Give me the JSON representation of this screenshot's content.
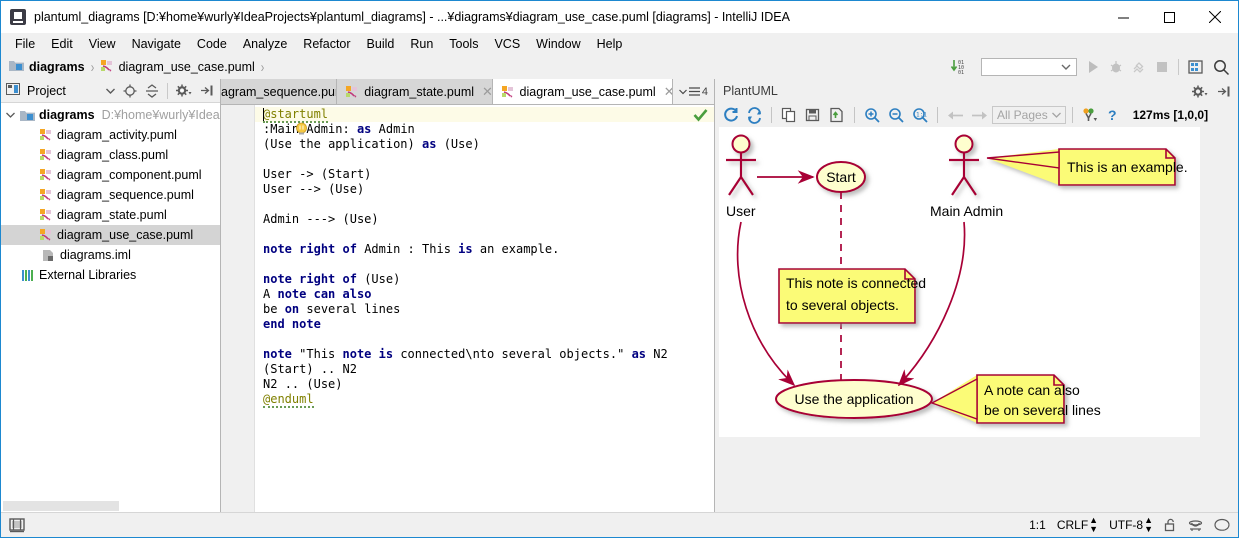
{
  "window": {
    "title": "plantuml_diagrams [D:¥home¥wurly¥IdeaProjects¥plantuml_diagrams] - ...¥diagrams¥diagram_use_case.puml [diagrams] - IntelliJ IDEA",
    "app_icon": "intellij-idea-icon",
    "minimize": "–",
    "maximize": "□",
    "close": "✕"
  },
  "menubar": {
    "items": [
      {
        "label": "File"
      },
      {
        "label": "Edit"
      },
      {
        "label": "View"
      },
      {
        "label": "Navigate"
      },
      {
        "label": "Code"
      },
      {
        "label": "Analyze"
      },
      {
        "label": "Refactor"
      },
      {
        "label": "Build"
      },
      {
        "label": "Run"
      },
      {
        "label": "Tools"
      },
      {
        "label": "VCS"
      },
      {
        "label": "Window"
      },
      {
        "label": "Help"
      }
    ]
  },
  "navbar": {
    "crumbs": [
      {
        "label": "diagrams",
        "icon": "module-folder-icon"
      },
      {
        "label": "diagram_use_case.puml",
        "icon": "puml-file-icon"
      }
    ],
    "separator": "›",
    "run_config_placeholder": "",
    "icons": [
      "download-binary-icon",
      "run-icon",
      "debug-icon",
      "coverage-icon",
      "stop-icon",
      "database-icon",
      "search-everywhere-icon"
    ]
  },
  "project_panel": {
    "title": "Project",
    "header_icon": "project-view-icon",
    "tools": [
      "chevron-down-icon",
      "locate-target-icon",
      "collapse-all-icon",
      "settings-gear-icon",
      "hide-panel-icon"
    ],
    "tree": [
      {
        "label": "diagrams",
        "path": "D:¥home¥wurly¥IdeaPro",
        "icon": "module-folder-icon",
        "indent": 0,
        "twisty": "⌄",
        "bold": true,
        "selected": false
      },
      {
        "label": "diagram_activity.puml",
        "path": "",
        "icon": "puml-file-icon",
        "indent": 1,
        "twisty": "",
        "bold": false,
        "selected": false
      },
      {
        "label": "diagram_class.puml",
        "path": "",
        "icon": "puml-file-icon",
        "indent": 1,
        "twisty": "",
        "bold": false,
        "selected": false
      },
      {
        "label": "diagram_component.puml",
        "path": "",
        "icon": "puml-file-icon",
        "indent": 1,
        "twisty": "",
        "bold": false,
        "selected": false
      },
      {
        "label": "diagram_sequence.puml",
        "path": "",
        "icon": "puml-file-icon",
        "indent": 1,
        "twisty": "",
        "bold": false,
        "selected": false
      },
      {
        "label": "diagram_state.puml",
        "path": "",
        "icon": "puml-file-icon",
        "indent": 1,
        "twisty": "",
        "bold": false,
        "selected": false
      },
      {
        "label": "diagram_use_case.puml",
        "path": "",
        "icon": "puml-file-icon",
        "indent": 1,
        "twisty": "",
        "bold": false,
        "selected": true
      },
      {
        "label": "diagrams.iml",
        "path": "",
        "icon": "iml-file-icon",
        "indent": 1,
        "twisty": "",
        "bold": false,
        "selected": false
      },
      {
        "label": "External Libraries",
        "path": "",
        "icon": "libraries-icon",
        "indent": 0,
        "twisty": "",
        "bold": false,
        "selected": false
      }
    ]
  },
  "editor": {
    "tabs": [
      {
        "label": "agram_sequence.puml",
        "icon": "",
        "active": false,
        "clipped": true
      },
      {
        "label": "diagram_state.puml",
        "icon": "puml-file-icon",
        "active": false,
        "clipped": false
      },
      {
        "label": "diagram_use_case.puml",
        "icon": "puml-file-icon",
        "active": true,
        "clipped": false
      }
    ],
    "tab_close": "✕",
    "tab_list_count": "4",
    "inspection_status": "inspections-ok-icon",
    "intention_bulb": "lightbulb-icon",
    "code_lines": [
      "@startuml",
      ":Main Admin: as Admin",
      "(Use the application) as (Use)",
      "",
      "User -> (Start)",
      "User --> (Use)",
      "",
      "Admin ---> (Use)",
      "",
      "note right of Admin : This is an example.",
      "",
      "note right of (Use)",
      "A note can also",
      "be on several lines",
      "end note",
      "",
      "note \"This note is connected\\nto several objects.\" as N2",
      "(Start) .. N2",
      "N2 .. (Use)",
      "@enduml"
    ]
  },
  "uml_panel": {
    "title": "PlantUML",
    "header_tools": [
      "settings-gear-icon",
      "hide-panel-icon"
    ],
    "toolbar_icons": [
      "reload-icon",
      "auto-reload-icon",
      "copy-icon",
      "save-icon",
      "export-icon",
      "zoom-in-icon",
      "zoom-out-icon",
      "zoom-actual-icon",
      "prev-page-icon",
      "next-page-icon"
    ],
    "pages_label": "All Pages",
    "pages_chevron": "⌄",
    "preferences_icon": "preferences-icon",
    "help_icon": "help-question-icon",
    "render_time": "127ms [1,0,0]"
  },
  "diagram": {
    "actors": [
      {
        "id": "user",
        "label": "User"
      },
      {
        "id": "admin",
        "label": "Main Admin"
      }
    ],
    "usecases": [
      {
        "id": "start",
        "label": "Start"
      },
      {
        "id": "use",
        "label": "Use the application"
      }
    ],
    "notes": [
      {
        "id": "n-example",
        "lines": [
          "This is an example."
        ]
      },
      {
        "id": "n2",
        "lines": [
          "This note is connected",
          "to several objects."
        ]
      },
      {
        "id": "n-multiline",
        "lines": [
          "A note can also",
          "be on several lines"
        ]
      }
    ],
    "colors": {
      "stroke": "#A80036",
      "usecase_fill": "#FEFECE",
      "note_fill": "#FBFB77",
      "shadow": "#B0B0B0"
    }
  },
  "statusbar": {
    "left_icon": "toggle-tool-windows-icon",
    "caret_position": "1:1",
    "line_separator": "CRLF",
    "encoding": "UTF-8",
    "updown_glyph": "↕",
    "lock_icon": "lock-icon",
    "hector_icon": "hector-inspection-icon",
    "event_log_icon": "event-log-icon"
  }
}
